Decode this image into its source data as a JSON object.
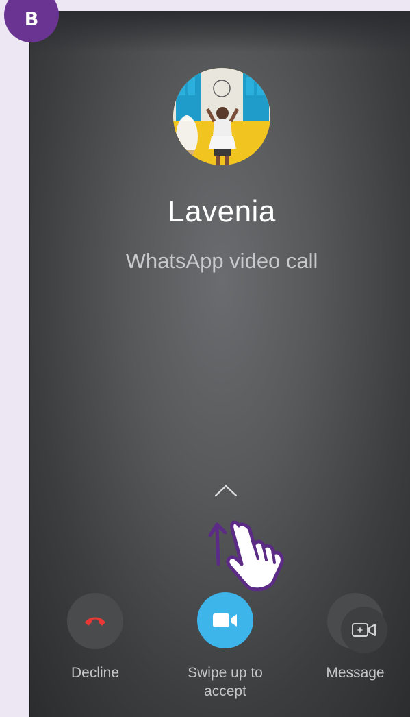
{
  "badge": {
    "letter": "B"
  },
  "call": {
    "caller_name": "Lavenia",
    "call_type": "WhatsApp video call"
  },
  "actions": {
    "decline_label": "Decline",
    "accept_label": "Swipe up to accept",
    "message_label": "Message"
  },
  "colors": {
    "badge": "#6a3492",
    "accept": "#3eb5ea",
    "decline_icon": "#e53935",
    "gesture_hint": "#5b2b86"
  },
  "icons": {
    "decline": "phone-hangup-icon",
    "accept": "video-camera-icon",
    "message": "message-icon",
    "swipe": "chevron-up-icon",
    "gesture": "swipe-up-hand-icon"
  }
}
